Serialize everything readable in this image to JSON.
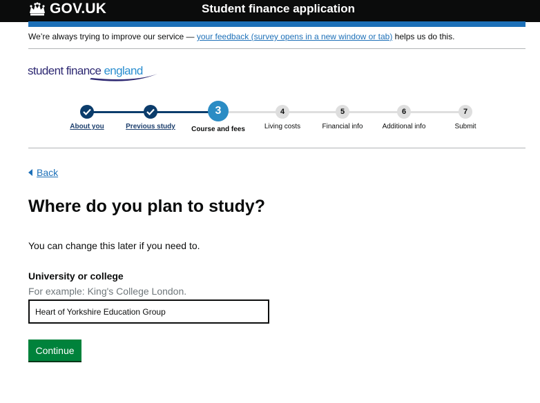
{
  "header": {
    "logo_text": "GOV.UK",
    "service_name": "Student finance application",
    "crown_icon": "crown-icon"
  },
  "feedback": {
    "prefix": "We’re always trying to improve our service — ",
    "link": "your feedback (survey opens in a new window or tab)",
    "suffix": " helps us do this."
  },
  "sfe_logo": {
    "part1": "student finance ",
    "part2": "england"
  },
  "stepper": {
    "steps": [
      {
        "number": "1",
        "label": "About you",
        "state": "done"
      },
      {
        "number": "2",
        "label": "Previous study",
        "state": "done"
      },
      {
        "number": "3",
        "label": "Course and fees",
        "state": "current"
      },
      {
        "number": "4",
        "label": "Living costs",
        "state": "upcoming"
      },
      {
        "number": "5",
        "label": "Financial info",
        "state": "upcoming"
      },
      {
        "number": "6",
        "label": "Additional info",
        "state": "upcoming"
      },
      {
        "number": "7",
        "label": "Submit",
        "state": "upcoming"
      }
    ],
    "done_color": "#0b3c6b",
    "current_color": "#2b8cc4",
    "upcoming_color": "#dedede"
  },
  "back_link": "Back",
  "page_title": "Where do you plan to study?",
  "hint_paragraph": "You can change this later if you need to.",
  "field": {
    "label": "University or college",
    "hint": "For example: King's College London.",
    "value": "Heart of Yorkshire Education Group"
  },
  "continue_label": "Continue",
  "colors": {
    "header_bg": "#0b0c0c",
    "blue_bar": "#1d70b8",
    "link": "#1d70b8",
    "button": "#00823b"
  }
}
